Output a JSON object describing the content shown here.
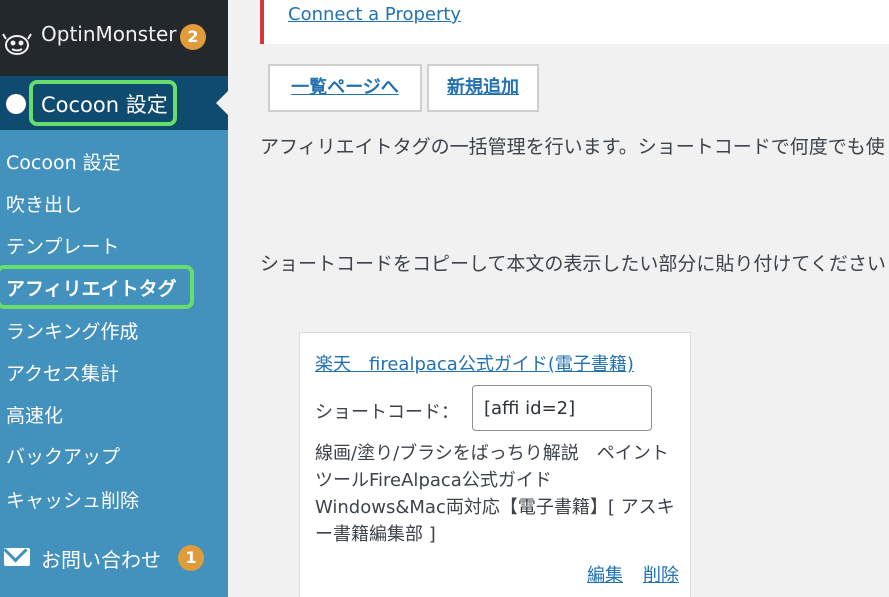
{
  "sidebar": {
    "optinmonster": {
      "label": "OptinMonster",
      "badge": "2"
    },
    "cocoon": {
      "label": "Cocoon 設定"
    },
    "submenu": [
      "Cocoon 設定",
      "吹き出し",
      "テンプレート",
      "アフィリエイトタグ",
      "ランキング作成",
      "アクセス集計",
      "高速化",
      "バックアップ",
      "キャッシュ削除"
    ],
    "contact": {
      "label": "お問い合わせ",
      "badge": "1"
    }
  },
  "notice": {
    "link": "Connect a Property"
  },
  "toolbar": {
    "list_label": "一覧ページへ",
    "new_label": "新規追加"
  },
  "main": {
    "description_1": "アフィリエイトタグの一括管理を行います。ショートコードで何度でも使",
    "description_2": "ショートコードをコピーして本文の表示したい部分に貼り付けてください"
  },
  "card": {
    "title": "楽天　firealpaca公式ガイド(電子書籍)",
    "shortcode_label": "ショートコード：",
    "shortcode_value": "[affi id=2]",
    "description": "線画/塗り/ブラシをばっちり解説　ペイントツールFireAlpaca公式ガイド Windows&Mac両対応【電子書籍】[ アスキー書籍編集部 ]",
    "edit_label": "編集",
    "delete_label": "削除"
  },
  "colors": {
    "sidebar_bg": "#23282d",
    "active_menu": "#0f4b6e",
    "submenu_bg": "#4391bd",
    "highlight": "#67dd6c",
    "badge": "#e09b3a",
    "link": "#2271b1"
  }
}
